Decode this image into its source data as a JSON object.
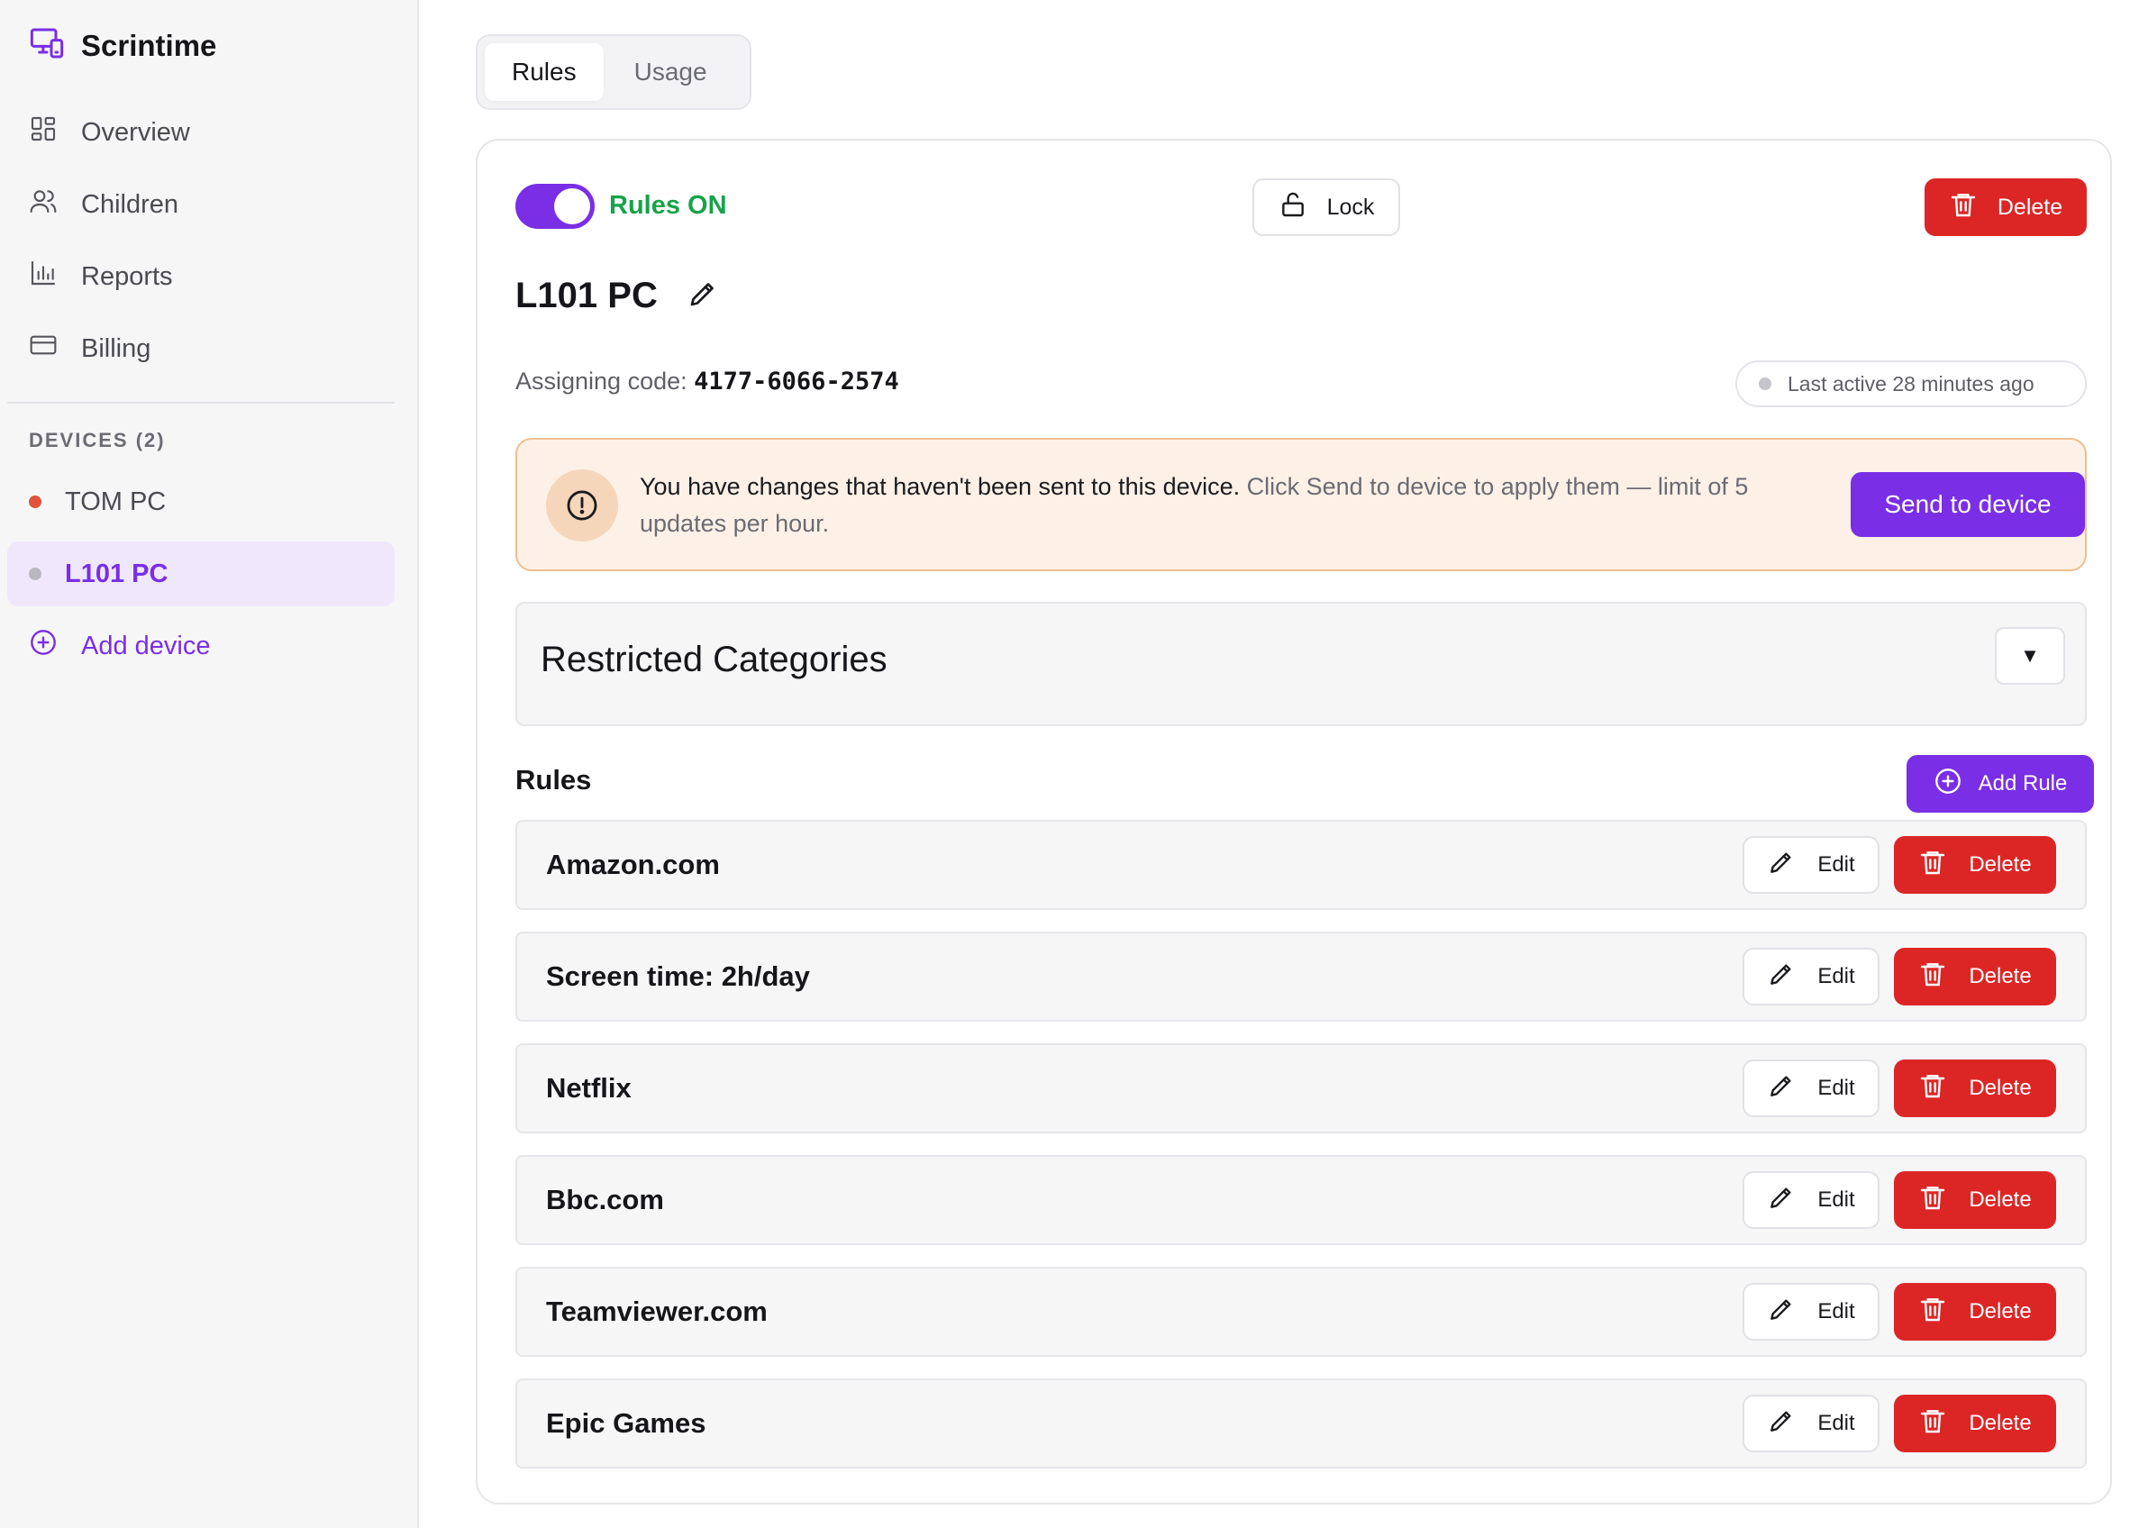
{
  "app": {
    "name": "Scrintime",
    "icon": "devices-icon"
  },
  "sidebar": {
    "nav": [
      {
        "label": "Overview",
        "icon": "grid-icon"
      },
      {
        "label": "Children",
        "icon": "users-icon"
      },
      {
        "label": "Reports",
        "icon": "bar-chart-icon"
      },
      {
        "label": "Billing",
        "icon": "credit-card-icon"
      }
    ],
    "devices_heading": "DEVICES (2)",
    "devices": [
      {
        "label": "TOM PC",
        "status_color": "#e0533a"
      },
      {
        "label": "L101 PC",
        "status_color": "#b8b8be",
        "active": true
      }
    ],
    "add_device_label": "Add device"
  },
  "tabs": [
    {
      "label": "Rules",
      "active": true
    },
    {
      "label": "Usage",
      "active": false
    }
  ],
  "device": {
    "rules_status": "Rules ON",
    "rules_enabled": true,
    "lock_label": "Lock",
    "delete_label": "Delete",
    "name": "L101 PC",
    "assign_label": "Assigning code:",
    "assign_code": "4177-6066-2574",
    "last_active": "Last active 28 minutes ago"
  },
  "alert": {
    "strong": "You have changes that haven't been sent to this device.",
    "rest": " Click Send to device to apply them — limit of 5 updates per hour.",
    "button": "Send to device"
  },
  "restricted": {
    "title": "Restricted Categories",
    "toggle": "▼"
  },
  "rules": {
    "heading": "Rules",
    "add_label": "Add Rule",
    "edit_label": "Edit",
    "delete_label": "Delete",
    "items": [
      {
        "name": "Amazon.com"
      },
      {
        "name": "Screen time: 2h/day"
      },
      {
        "name": "Netflix"
      },
      {
        "name": "Bbc.com"
      },
      {
        "name": "Teamviewer.com"
      },
      {
        "name": "Epic Games"
      }
    ]
  },
  "colors": {
    "accent": "#7a2ee6",
    "danger": "#dc2626",
    "success": "#17a34a",
    "alert_bg": "#fdf1e7",
    "alert_border": "#efbf8f"
  }
}
